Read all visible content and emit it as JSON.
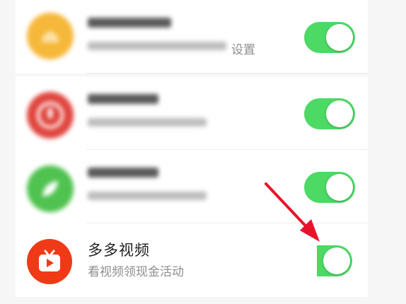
{
  "settings_list": {
    "items": [
      {
        "title": "多多视频",
        "subtitle": "看视频领现金活动",
        "enabled": true,
        "icon": "play-tv-icon",
        "icon_color": "#f03a17"
      }
    ],
    "blurred_subtitle_suffix": "设置"
  },
  "colors": {
    "toggle_on": "#4cd964",
    "annotation_arrow": "#e8132b"
  }
}
